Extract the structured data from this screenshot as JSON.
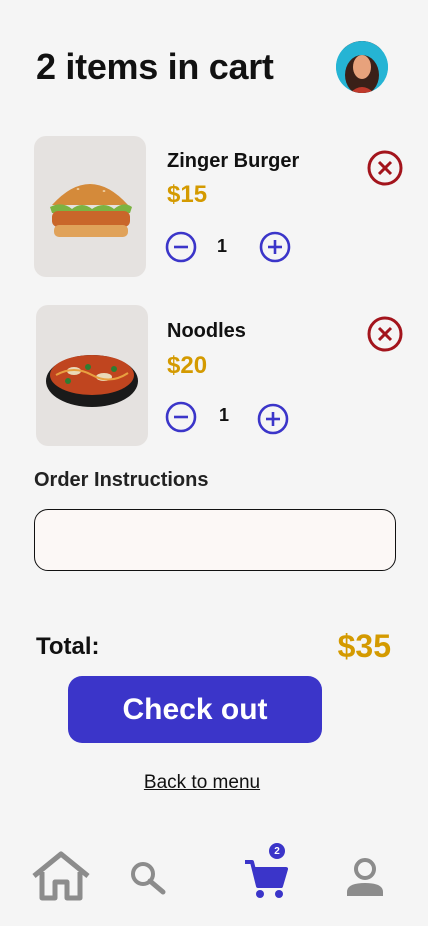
{
  "header": {
    "title": "2 items in cart"
  },
  "cart": {
    "items": [
      {
        "name": "Zinger Burger",
        "price": "$15",
        "quantity": "1"
      },
      {
        "name": "Noodles",
        "price": "$20",
        "quantity": "1"
      }
    ]
  },
  "instructions": {
    "label": "Order Instructions",
    "value": "",
    "placeholder": ""
  },
  "summary": {
    "total_label": "Total:",
    "total_value": "$35"
  },
  "actions": {
    "checkout_label": "Check out",
    "back_label": "Back to menu"
  },
  "nav": {
    "items": [
      "home-icon",
      "search-icon",
      "cart-icon",
      "profile-icon"
    ],
    "active": "cart-icon",
    "cart_badge": "2"
  },
  "colors": {
    "accent": "#3b35c9",
    "price": "#d49a00",
    "remove": "#a3141c",
    "inactive": "#8c8c8c"
  }
}
